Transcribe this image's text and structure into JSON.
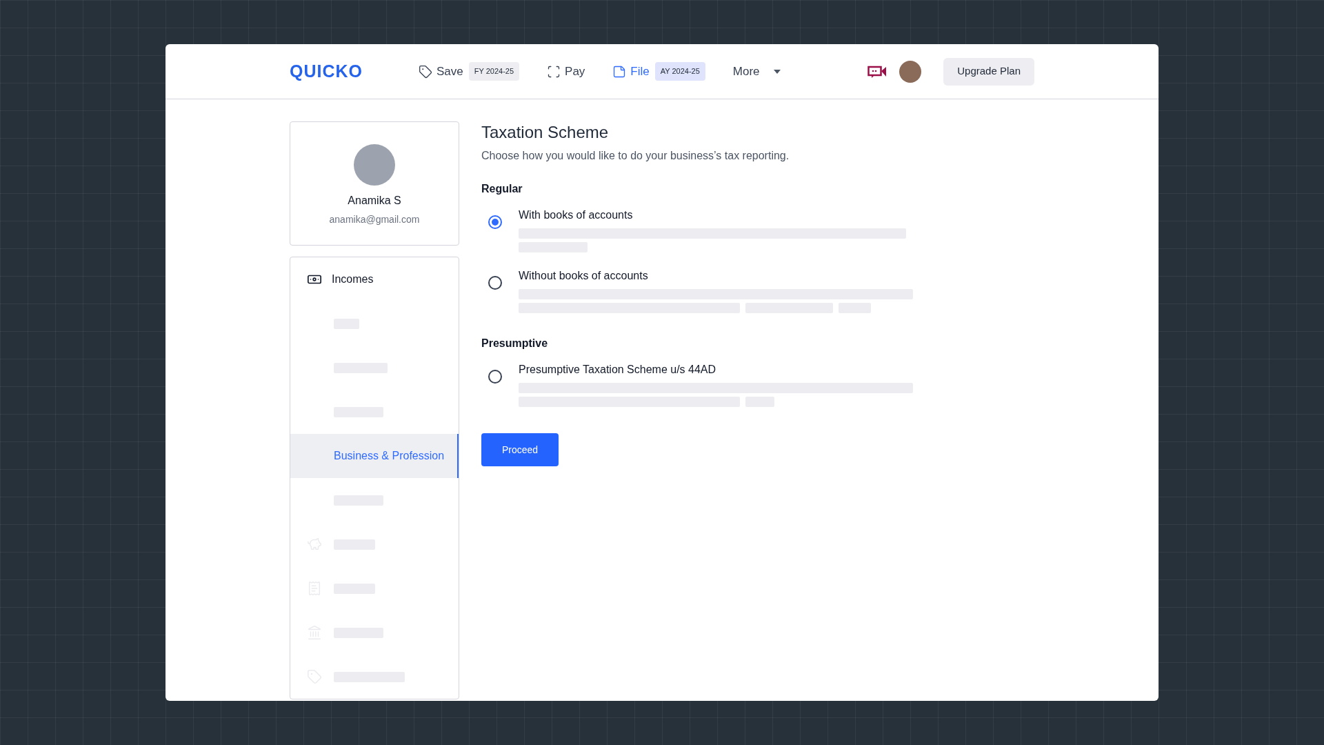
{
  "header": {
    "logo": "QUICKO",
    "nav": [
      {
        "kind": "save",
        "label": "Save",
        "badge": "FY 2024-25",
        "selected": false
      },
      {
        "kind": "pay",
        "label": "Pay",
        "selected": false
      },
      {
        "kind": "file",
        "label": "File",
        "badge": "AY 2024-25",
        "selected": true
      },
      {
        "kind": "more",
        "label": "More",
        "selected": false
      }
    ],
    "upgrade_button": "Upgrade Plan"
  },
  "profile": {
    "name": "Anamika S",
    "email": "anamika@gmail.com"
  },
  "sidebar": {
    "section": "Incomes",
    "items": [
      {
        "kind": "skeleton",
        "selected": false
      },
      {
        "kind": "skeleton",
        "selected": false
      },
      {
        "kind": "skeleton",
        "selected": false
      },
      {
        "kind": "link",
        "label": "Business & Profession",
        "selected": true
      },
      {
        "kind": "skeleton",
        "selected": false
      },
      {
        "kind": "skeleton",
        "selected": false
      },
      {
        "kind": "skeleton",
        "selected": false
      },
      {
        "kind": "skeleton",
        "selected": false
      },
      {
        "kind": "skeleton",
        "selected": false
      }
    ]
  },
  "main": {
    "title": "Taxation Scheme",
    "subtitle": "Choose how you would like to do your business’s tax reporting.",
    "groups": [
      {
        "title": "Regular",
        "options": [
          {
            "label": "With books of accounts",
            "selected": true
          },
          {
            "label": "Without books of accounts",
            "selected": false
          }
        ]
      },
      {
        "title": "Presumptive",
        "options": [
          {
            "label": "Presumptive Taxation Scheme u/s 44AD",
            "selected": false
          }
        ]
      }
    ],
    "proceed_button": "Proceed"
  }
}
